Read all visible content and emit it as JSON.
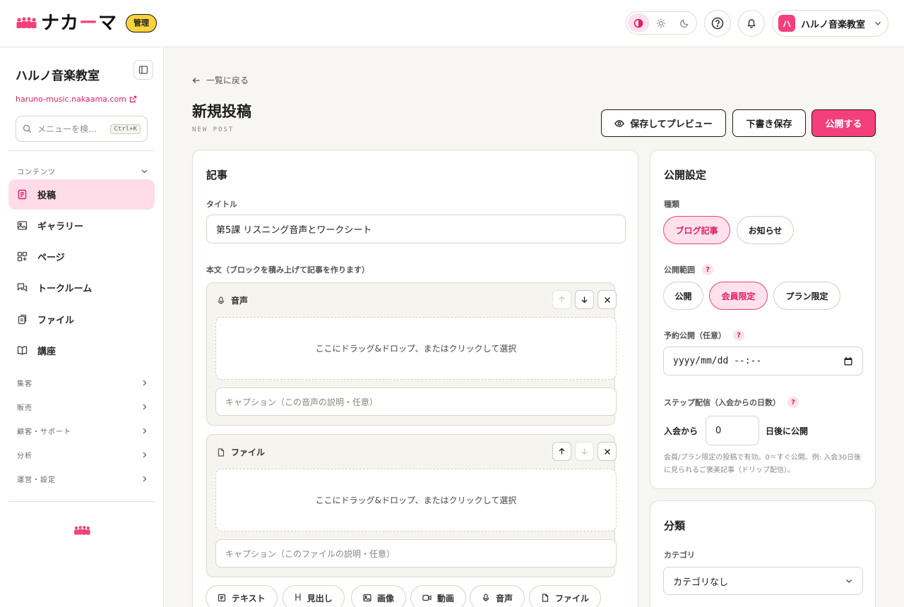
{
  "brand": {
    "name_pre": "ナカ",
    "name_dash": "ー",
    "name_post": "マ",
    "admin_badge": "管理"
  },
  "header": {
    "theme_options": [
      "contrast-icon",
      "sun-icon",
      "moon-icon"
    ],
    "account": {
      "avatar": "ハ",
      "name": "ハルノ音楽教室"
    }
  },
  "sidebar": {
    "title": "ハルノ音楽教室",
    "url": "haruno-music.nakaama.com",
    "search": {
      "placeholder": "メニューを検…",
      "shortcut": "Ctrl+K"
    },
    "content_group": "コンテンツ",
    "items": [
      {
        "label": "投稿",
        "icon": "document-icon",
        "active": true
      },
      {
        "label": "ギャラリー",
        "icon": "image-icon"
      },
      {
        "label": "ページ",
        "icon": "layout-icon"
      },
      {
        "label": "トークルーム",
        "icon": "chat-icon"
      },
      {
        "label": "ファイル",
        "icon": "files-icon"
      },
      {
        "label": "講座",
        "icon": "book-icon"
      }
    ],
    "groups": [
      "集客",
      "販売",
      "顧客・サポート",
      "分析",
      "運営・設定"
    ]
  },
  "page": {
    "back_label": "一覧に戻る",
    "title": "新規投稿",
    "subtitle": "NEW POST",
    "preview_button": "保存してプレビュー",
    "draft_button": "下書き保存",
    "publish_button": "公開する"
  },
  "article": {
    "heading": "記事",
    "title_label": "タイトル",
    "title_value": "第5課 リスニング音声とワークシート",
    "body_label": "本文（ブロックを積み上げて記事を作ります）",
    "blocks": [
      {
        "type": "音声",
        "icon": "mic-icon",
        "dropzone": "ここにドラッグ&ドロップ、またはクリックして選択",
        "caption_placeholder": "キャプション（この音声の説明・任意）"
      },
      {
        "type": "ファイル",
        "icon": "file-icon",
        "dropzone": "ここにドラッグ&ドロップ、またはクリックして選択",
        "caption_placeholder": "キャプション（このファイルの説明・任意）"
      }
    ],
    "add_buttons": [
      "テキスト",
      "見出し",
      "画像",
      "動画",
      "音声",
      "ファイル"
    ]
  },
  "publish_settings": {
    "heading": "公開設定",
    "type_label": "種類",
    "types": [
      "ブログ記事",
      "お知らせ"
    ],
    "selected_type": "ブログ記事",
    "visibility_label": "公開範囲",
    "visibility_options": [
      "公開",
      "会員限定",
      "プラン限定"
    ],
    "selected_visibility": "会員限定",
    "schedule_label": "予約公開（任意）",
    "schedule_placeholder": "yyyy/mm/dd --:--",
    "step_label": "ステップ配信（入会からの日数）",
    "step_prefix": "入会から",
    "step_value": "0",
    "step_suffix": "日後に公開",
    "hint": "会員/プラン限定の投稿で有効。0＝すぐ公開。例: 入会30日後に見られるご褒美記事（ドリップ配信）。"
  },
  "classification": {
    "heading": "分類",
    "category_label": "カテゴリ",
    "category_value": "カテゴリなし"
  },
  "colors": {
    "accent": "#f43f7d",
    "accent_soft": "#ffe1ec",
    "badge": "#f8d33d",
    "background": "#f7f6f2"
  }
}
